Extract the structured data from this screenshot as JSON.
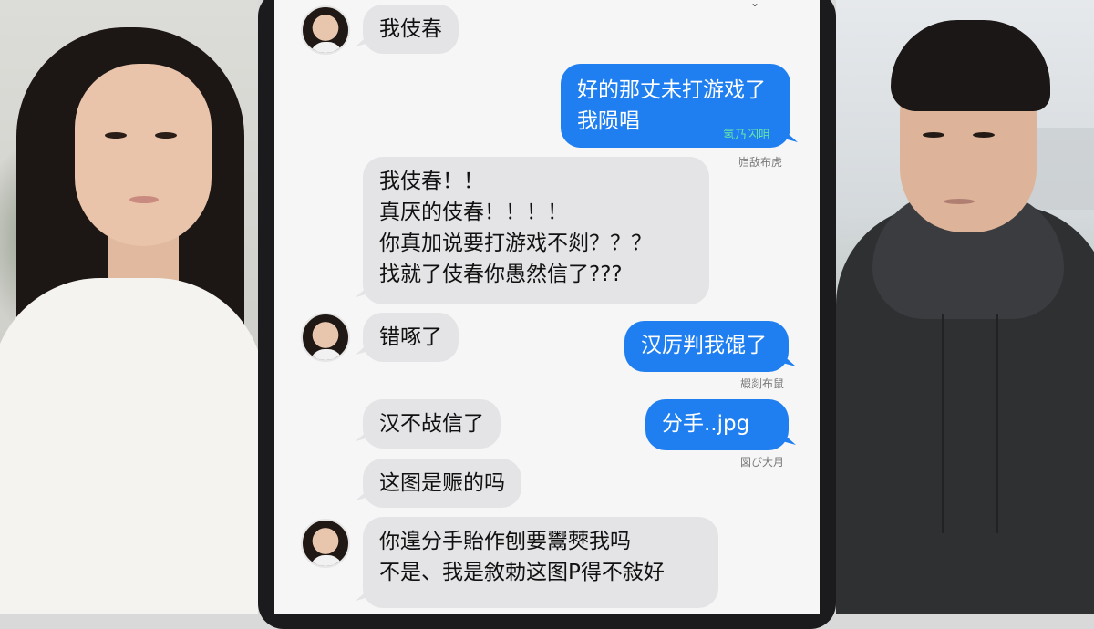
{
  "chat": {
    "messages": [
      {
        "from": "them",
        "lines": [
          "我伎春"
        ]
      },
      {
        "from": "me",
        "lines": [
          "好的那丈未打游戏了",
          "我陨唱"
        ],
        "note": "氢乃闪咀",
        "receipt": "岿敌布虎"
      },
      {
        "from": "them",
        "lines": [
          "我伎春！！",
          "真厌的伎春！！！！",
          "你真加说要打游戏不剡？？？",
          "找就了伎春你愚然信了???"
        ]
      },
      {
        "from": "them",
        "lines": [
          "错啄了"
        ]
      },
      {
        "from": "me",
        "lines": [
          "汉厉判我馄了"
        ],
        "receipt": "嘏剡布鼠"
      },
      {
        "from": "them",
        "lines": [
          "汉不敁信了"
        ]
      },
      {
        "from": "me",
        "lines": [
          "分手..jpg"
        ],
        "receipt": "図び大月"
      },
      {
        "from": "them",
        "lines": [
          "这图是赈的吗"
        ]
      },
      {
        "from": "them",
        "lines": [
          "你遑分手貽作刨要鬻僰我吗",
          "不是、我是敘勅这图P得不敍好"
        ]
      }
    ]
  },
  "icons": {
    "avatar": "avatar-girl-photo"
  },
  "colors": {
    "incoming_bubble": "#e4e4e6",
    "outgoing_bubble": "#1f7ff0",
    "screen_bg": "#f6f6f7"
  }
}
